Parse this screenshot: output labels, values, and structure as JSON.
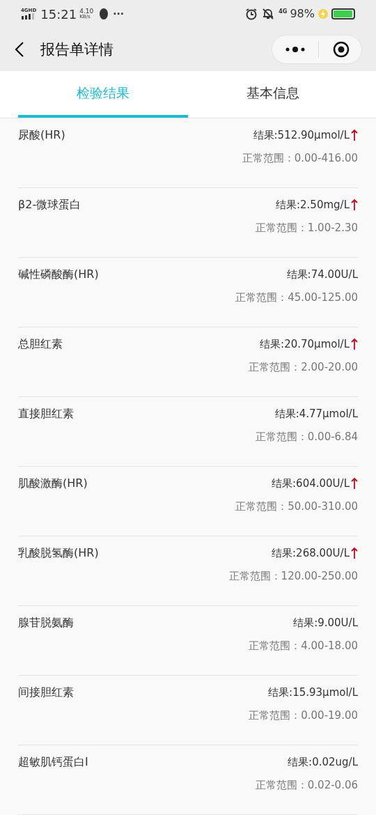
{
  "status_bar": {
    "network": "4GHD",
    "time": "15:21",
    "speed_value": "4.10",
    "speed_unit": "KB/s",
    "more": "···",
    "network_right": "4G",
    "battery": "98%"
  },
  "header": {
    "title": "报告单详情"
  },
  "tabs": [
    {
      "label": "检验结果",
      "selected": true
    },
    {
      "label": "基本信息",
      "selected": false
    }
  ],
  "results": [
    {
      "name": "尿酸(HR)",
      "result": "结果:512.90µmol/L",
      "high": true,
      "range": "正常范围：0.00-416.00"
    },
    {
      "name": "β2-微球蛋白",
      "result": "结果:2.50mg/L",
      "high": true,
      "range": "正常范围：1.00-2.30"
    },
    {
      "name": "碱性磷酸酶(HR)",
      "result": "结果:74.00U/L",
      "high": false,
      "range": "正常范围：45.00-125.00"
    },
    {
      "name": "总胆红素",
      "result": "结果:20.70µmol/L",
      "high": true,
      "range": "正常范围：2.00-20.00"
    },
    {
      "name": "直接胆红素",
      "result": "结果:4.77µmol/L",
      "high": false,
      "range": "正常范围：0.00-6.84"
    },
    {
      "name": "肌酸激酶(HR)",
      "result": "结果:604.00U/L",
      "high": true,
      "range": "正常范围：50.00-310.00"
    },
    {
      "name": "乳酸脱氢酶(HR)",
      "result": "结果:268.00U/L",
      "high": true,
      "range": "正常范围：120.00-250.00"
    },
    {
      "name": "腺苷脱氨酶",
      "result": "结果:9.00U/L",
      "high": false,
      "range": "正常范围：4.00-18.00"
    },
    {
      "name": "间接胆红素",
      "result": "结果:15.93µmol/L",
      "high": false,
      "range": "正常范围：0.00-19.00"
    },
    {
      "name": "超敏肌钙蛋白I",
      "result": "结果:0.02ug/L",
      "high": false,
      "range": "正常范围：0.02-0.06"
    }
  ]
}
